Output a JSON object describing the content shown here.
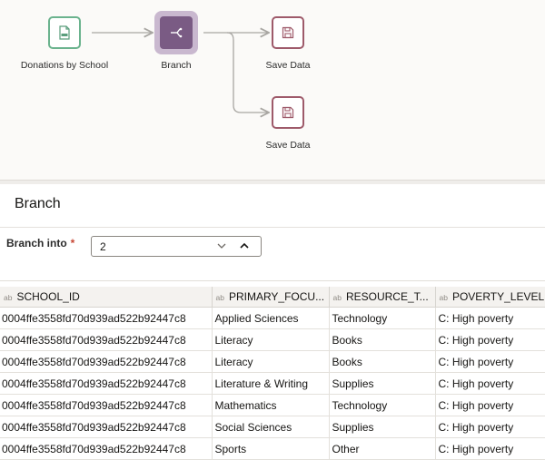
{
  "flow": {
    "nodes": {
      "source": {
        "label": "Donations by School",
        "icon": "csv-file-icon"
      },
      "branch": {
        "label": "Branch",
        "icon": "branch-icon"
      },
      "save1": {
        "label": "Save Data",
        "icon": "save-disk-icon"
      },
      "save2": {
        "label": "Save Data",
        "icon": "save-disk-icon"
      }
    },
    "colors": {
      "source_border": "#6bb38e",
      "branch_fill": "#7a5b84",
      "save_border": "#9e5a6a",
      "connector": "#a8a6a2"
    }
  },
  "panel": {
    "title": "Branch",
    "branch_into": {
      "label": "Branch into",
      "required_marker": "*",
      "value": "2"
    }
  },
  "table": {
    "type_tag": "ab",
    "columns": [
      "SCHOOL_ID",
      "PRIMARY_FOCU...",
      "RESOURCE_T...",
      "POVERTY_LEVEL"
    ],
    "rows": [
      [
        "0004ffe3558fd70d939ad522b92447c8",
        "Applied Sciences",
        "Technology",
        "C: High poverty"
      ],
      [
        "0004ffe3558fd70d939ad522b92447c8",
        "Literacy",
        "Books",
        "C: High poverty"
      ],
      [
        "0004ffe3558fd70d939ad522b92447c8",
        "Literacy",
        "Books",
        "C: High poverty"
      ],
      [
        "0004ffe3558fd70d939ad522b92447c8",
        "Literature & Writing",
        "Supplies",
        "C: High poverty"
      ],
      [
        "0004ffe3558fd70d939ad522b92447c8",
        "Mathematics",
        "Technology",
        "C: High poverty"
      ],
      [
        "0004ffe3558fd70d939ad522b92447c8",
        "Social Sciences",
        "Supplies",
        "C: High poverty"
      ],
      [
        "0004ffe3558fd70d939ad522b92447c8",
        "Sports",
        "Other",
        "C: High poverty"
      ]
    ]
  }
}
